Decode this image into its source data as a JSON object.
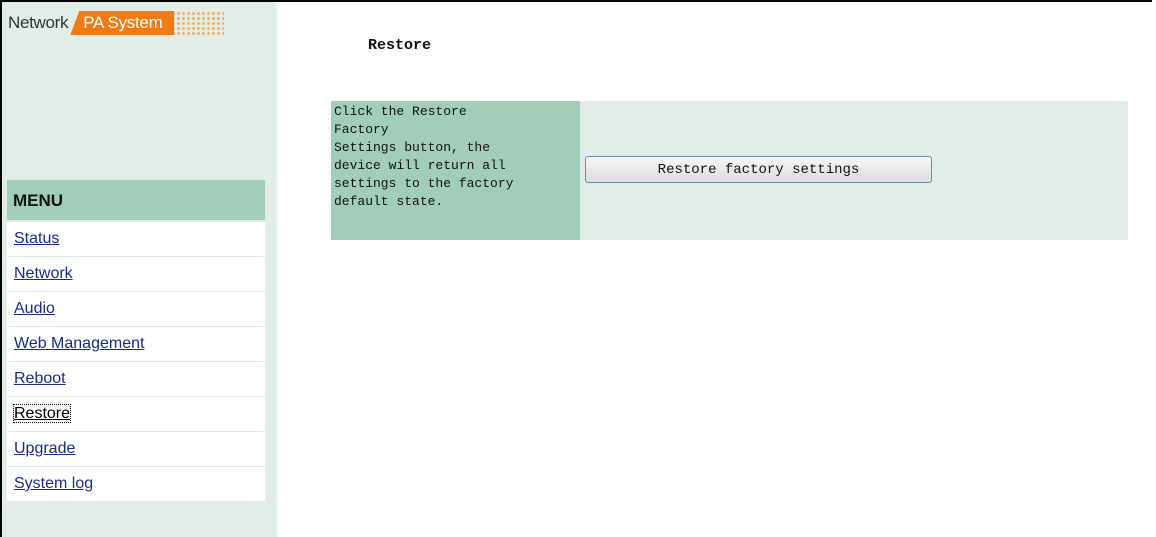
{
  "logo": {
    "network": "Network",
    "pa_system": "PA System"
  },
  "page": {
    "title": "Restore"
  },
  "menu": {
    "header": "MENU",
    "items": [
      {
        "label": "Status",
        "active": false
      },
      {
        "label": "Network",
        "active": false
      },
      {
        "label": "Audio",
        "active": false
      },
      {
        "label": "Web Management",
        "active": false
      },
      {
        "label": "Reboot",
        "active": false
      },
      {
        "label": "Restore",
        "active": true
      },
      {
        "label": "Upgrade",
        "active": false
      },
      {
        "label": "System log",
        "active": false
      }
    ]
  },
  "restore": {
    "description_lines": [
      "Click the Restore",
      "Factory",
      "Settings button, the",
      "device will return all",
      "settings to the factory",
      "default state."
    ],
    "button_label": "Restore factory settings"
  },
  "colors": {
    "sidebar_bg": "#e2ede8",
    "menu_header_bg": "#a2cdb9",
    "logo_orange": "#f07b16",
    "link": "#1a2a8a"
  }
}
